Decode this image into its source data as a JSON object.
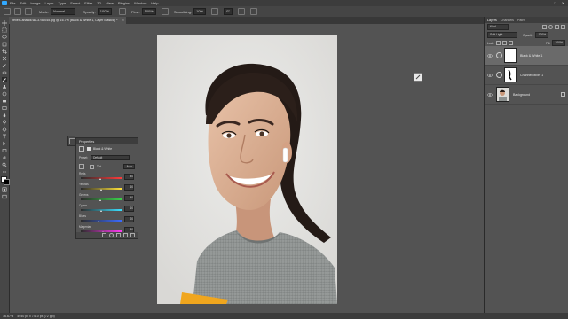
{
  "menubar": {
    "items": [
      "File",
      "Edit",
      "Image",
      "Layer",
      "Type",
      "Select",
      "Filter",
      "3D",
      "View",
      "Plugins",
      "Window",
      "Help"
    ],
    "window_controls": [
      "–",
      "□",
      "✕"
    ]
  },
  "options_bar": {
    "mode_label": "Mode:",
    "mode_value": "Normal",
    "opacity_label": "Opacity:",
    "opacity_value": "100%",
    "flow_label": "Flow:",
    "flow_value": "100%",
    "smoothing_label": "Smoothing:",
    "smoothing_value": "10%",
    "angle_value": "0°"
  },
  "document_tab": {
    "title": "pexels-anandl-ws-3756045.jpg @ 16.7% (Black & White 1, Layer Mask/8) *",
    "close": "×"
  },
  "properties": {
    "title": "Properties",
    "section": "Black & White",
    "preset_label": "Preset:",
    "preset_value": "Default",
    "tint_label": "Tint",
    "auto_label": "Auto",
    "sliders": [
      {
        "name": "Reds",
        "value": 40,
        "color_from": "#2b2b2b",
        "color_to": "#ff3b3b"
      },
      {
        "name": "Yellows",
        "value": 60,
        "color_from": "#2b2b2b",
        "color_to": "#ffe23b"
      },
      {
        "name": "Greens",
        "value": 40,
        "color_from": "#2b2b2b",
        "color_to": "#3bd14a"
      },
      {
        "name": "Cyans",
        "value": 60,
        "color_from": "#2b2b2b",
        "color_to": "#3be0ff"
      },
      {
        "name": "Blues",
        "value": 20,
        "color_from": "#2b2b2b",
        "color_to": "#3b6bff"
      },
      {
        "name": "Magentas",
        "value": 80,
        "color_from": "#2b2b2b",
        "color_to": "#ff3bf0"
      }
    ]
  },
  "layers_panel": {
    "tabs": [
      "Layers",
      "Channels",
      "Paths"
    ],
    "kind_label": "Kind",
    "blend_mode": "Soft Light",
    "opacity_label": "Opacity:",
    "opacity_value": "100%",
    "lock_label": "Lock:",
    "fill_label": "Fill:",
    "fill_value": "100%",
    "layers": [
      {
        "name": "Black & White 1",
        "selected": true
      },
      {
        "name": "Channel Mixer 1",
        "selected": false
      },
      {
        "name": "Background",
        "selected": false
      }
    ]
  },
  "statusbar": {
    "zoom": "16.67%",
    "doc_info": "4940 px x 7410 px (72 ppi)"
  },
  "colors": {
    "app_bg": "#535353",
    "panel_dark": "#3c3c3c",
    "accent": "#31a8ff",
    "selected_layer": "#6a6a6a"
  }
}
